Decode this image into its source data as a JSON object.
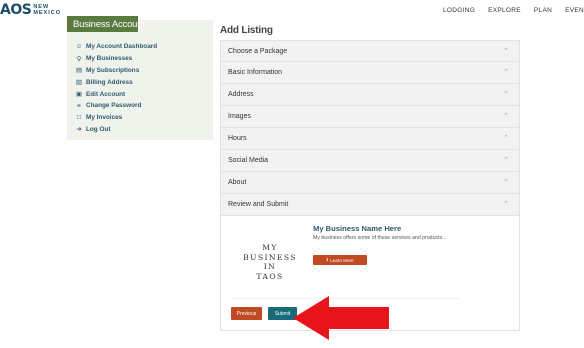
{
  "header": {
    "logo_mark": "AOS",
    "logo_line1": "NEW",
    "logo_line2": "MEXICO",
    "nav": [
      "LODGING",
      "EXPLORE",
      "PLAN",
      "EVEN"
    ]
  },
  "sidebar": {
    "title": "Business Account",
    "items": [
      {
        "label": "My Account Dashboard",
        "icon": "user-icon"
      },
      {
        "label": "My Businesses",
        "icon": "location-pin-icon"
      },
      {
        "label": "My Subscriptions",
        "icon": "list-icon"
      },
      {
        "label": "Billing Address",
        "icon": "document-icon"
      },
      {
        "label": "Edit Account",
        "icon": "id-card-icon"
      },
      {
        "label": "Change Password",
        "icon": "key-icon"
      },
      {
        "label": "My Invoices",
        "icon": "invoice-icon"
      },
      {
        "label": "Log Out",
        "icon": "logout-icon"
      }
    ]
  },
  "main": {
    "title": "Add Listing",
    "sections": [
      "Choose a Package",
      "Basic Information",
      "Address",
      "Images",
      "Hours",
      "Social Media",
      "About",
      "Review and Submit"
    ],
    "preview": {
      "logo_line1": "MY BUSINESS",
      "logo_line2": "IN",
      "logo_line3": "TAOS",
      "name": "My Business Name Here",
      "description": "My business offers some of these services and products...",
      "learn_more": "Learn More"
    },
    "previous_label": "Previous",
    "submit_label": "Submit"
  },
  "colors": {
    "sidebar_header": "#5a7a40",
    "accent_orange": "#c04a22",
    "accent_teal": "#1a6b7a",
    "arrow": "#e8141c"
  }
}
